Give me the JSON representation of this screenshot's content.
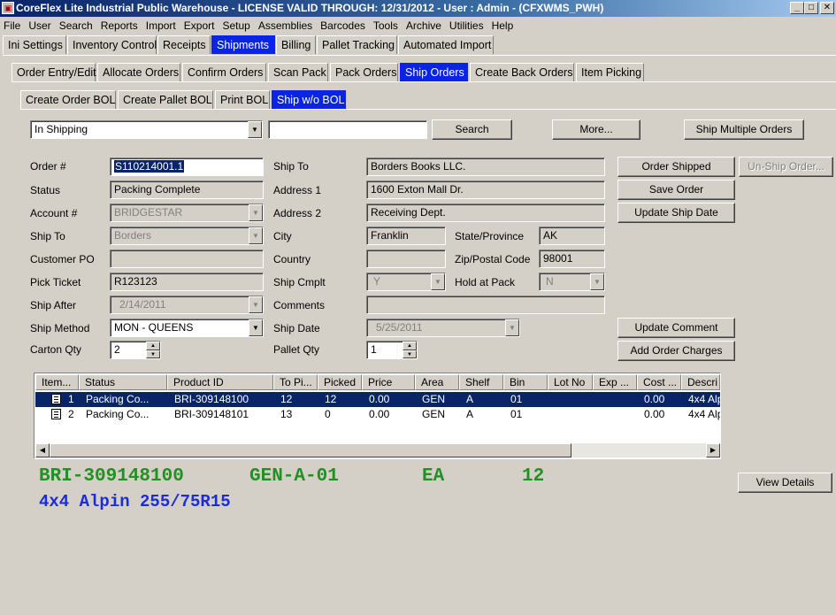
{
  "window": {
    "title": "CoreFlex Lite Industrial Public Warehouse - LICENSE VALID THROUGH: 12/31/2012 - User : Admin - (CFXWMS_PWH)",
    "icon": "app-icon",
    "minimize": "_",
    "maximize": "□",
    "close": "✕"
  },
  "menu": [
    "File",
    "User",
    "Search",
    "Reports",
    "Import",
    "Export",
    "Setup",
    "Assemblies",
    "Barcodes",
    "Tools",
    "Archive",
    "Utilities",
    "Help"
  ],
  "main_tabs": [
    "Ini Settings",
    "Inventory Control",
    "Receipts",
    "Shipments",
    "Billing",
    "Pallet Tracking",
    "Automated Import"
  ],
  "sub_tabs": [
    "Order Entry/Edit",
    "Allocate Orders",
    "Confirm Orders",
    "Scan Pack",
    "Pack Orders",
    "Ship Orders",
    "Create Back Orders",
    "Item Picking"
  ],
  "sub_sub_tabs": [
    "Create Order BOL",
    "Create Pallet BOL",
    "Print BOL",
    "Ship w/o BOL"
  ],
  "filter": {
    "status_value": "In Shipping",
    "search_value": "",
    "search_button": "Search",
    "more_button": "More...",
    "ship_multiple_button": "Ship Multiple Orders"
  },
  "form": {
    "order_no_label": "Order #",
    "order_no": "S110214001.1",
    "status_label": "Status",
    "status": "Packing Complete",
    "account_label": "Account #",
    "account": "BRIDGESTAR",
    "ship_to_label": "Ship To",
    "ship_to": "Borders",
    "customer_po_label": "Customer PO",
    "customer_po": "",
    "pick_ticket_label": "Pick Ticket",
    "pick_ticket": "R123123",
    "ship_after_label": "Ship After",
    "ship_after": "2/14/2011",
    "ship_method_label": "Ship Method",
    "ship_method": "MON - QUEENS",
    "carton_qty_label": "Carton Qty",
    "carton_qty": "2",
    "ship_to_name_label": "Ship To",
    "ship_to_name": "Borders Books LLC.",
    "address1_label": "Address 1",
    "address1": "1600 Exton Mall Dr.",
    "address2_label": "Address 2",
    "address2": "Receiving Dept.",
    "city_label": "City",
    "city": "Franklin",
    "state_label": "State/Province",
    "state": "AK",
    "country_label": "Country",
    "country": "",
    "zip_label": "Zip/Postal Code",
    "zip": "98001",
    "ship_cmplt_label": "Ship Cmplt",
    "ship_cmplt": "Y",
    "hold_label": "Hold at Pack",
    "hold": "N",
    "comments_label": "Comments",
    "comments": "",
    "ship_date_label": "Ship Date",
    "ship_date": "5/25/2011",
    "pallet_qty_label": "Pallet Qty",
    "pallet_qty": "1"
  },
  "actions": {
    "order_shipped": "Order Shipped",
    "unship": "Un-Ship Order...",
    "save": "Save Order",
    "update_ship_date": "Update Ship Date",
    "update_comment": "Update Comment",
    "add_charges": "Add Order Charges",
    "view_details": "View Details"
  },
  "grid": {
    "columns": [
      "Item...",
      "Status",
      "Product ID",
      "To Pi...",
      "Picked",
      "Price",
      "Area",
      "Shelf",
      "Bin",
      "Lot No",
      "Exp ...",
      "Cost ...",
      "Descri"
    ],
    "rows": [
      [
        "1",
        "Packing Co...",
        "BRI-309148100",
        "12",
        "12",
        "0.00",
        "GEN",
        "A",
        "01",
        "",
        "",
        "0.00",
        "4x4 Alp"
      ],
      [
        "2",
        "Packing Co...",
        "BRI-309148101",
        "13",
        "0",
        "0.00",
        "GEN",
        "A",
        "01",
        "",
        "",
        "0.00",
        "4x4 Alp"
      ]
    ],
    "scroll_left": "◀",
    "scroll_right": "▶"
  },
  "detail": {
    "product": "BRI-309148100",
    "location": "GEN-A-01",
    "uom": "EA",
    "qty": "12",
    "description": "4x4 Alpin 255/75R15"
  }
}
